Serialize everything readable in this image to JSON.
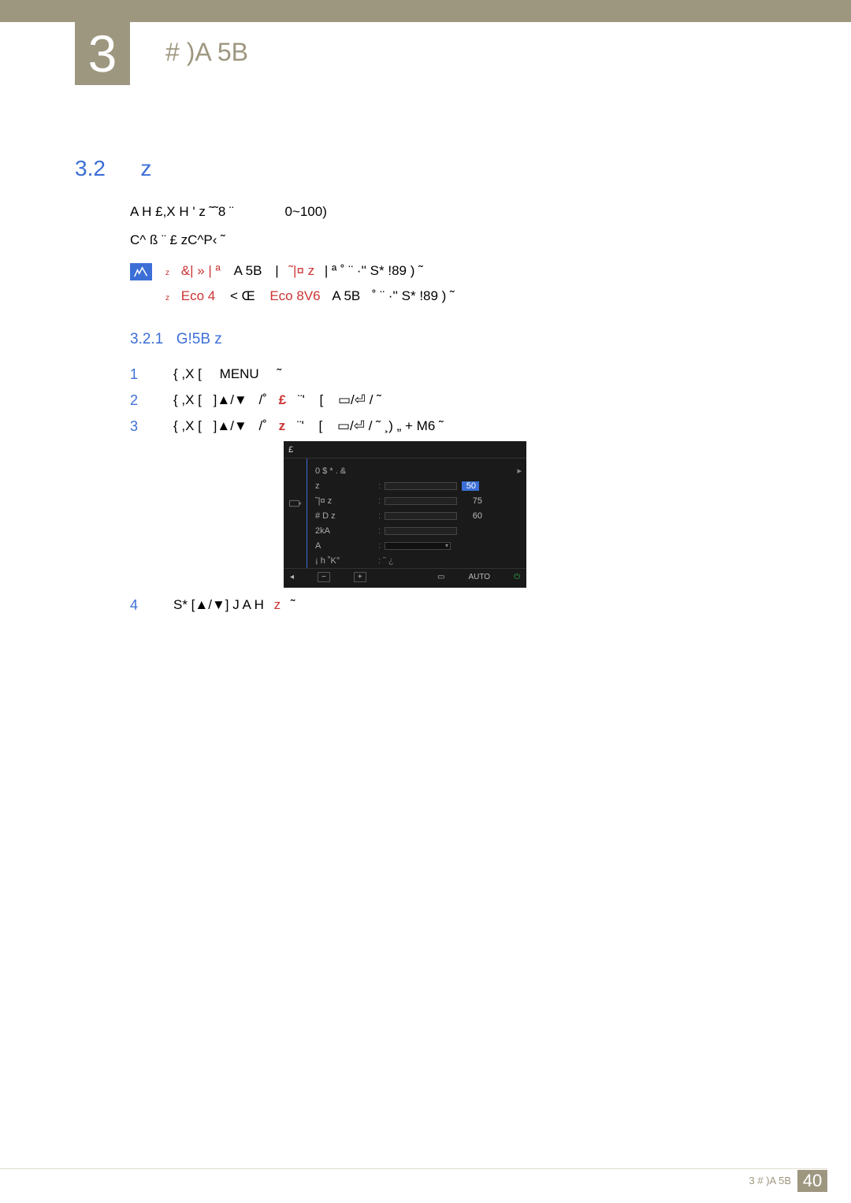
{
  "chapter": {
    "number": "3",
    "title": "# )A 5B"
  },
  "section": {
    "number": "3.2",
    "title": "z"
  },
  "intro": {
    "line1_left": "A H  £,X H '  z ˜˜8  ¨",
    "line1_right": "0~100)",
    "line2": " C^ ß ¨  £   zC^P‹ ˜"
  },
  "notes": [
    {
      "pre": "&| » | ª",
      "mid": "A 5B",
      "accent": "˜|¤ z",
      "tail": "  | ª ˚ ¨ ·'' S* !89  ) ˜"
    },
    {
      "pre": "Eco  4",
      "mid": "<  Œ",
      "accent": "Eco 8V6",
      "post": " A 5B",
      "tail": "˚ ¨ ·'' S* !89  ) ˜"
    }
  ],
  "subsection": {
    "number": "3.2.1",
    "title": "G!5B  z"
  },
  "steps": {
    "s1": {
      "num": "1",
      "text_a": "{  ,X [",
      "menu": "MENU",
      "text_c": "˜"
    },
    "s2": {
      "num": "2",
      "text_a": "{  ,X [",
      "arrows": "]▲/▼",
      "mid": "/˚",
      "accent": "£",
      "mid2": "¨'",
      "bracket": "[",
      "tail": "/      ˜"
    },
    "s3": {
      "num": "3",
      "text_a": "{  ,X [",
      "arrows": "]▲/▼",
      "mid": "/˚",
      "accent": "z",
      "mid2": "¨'",
      "bracket": "[",
      "tail": "/      ˜  ¸) „ + M6 ˜"
    },
    "s4": {
      "num": "4",
      "text_a": "S*   [▲/▼]  J A H",
      "accent": "z",
      "tail": "˜"
    }
  },
  "osd": {
    "header": "£",
    "rows": [
      {
        "label": "0 $ * . &",
        "type": "arrow",
        "value": ""
      },
      {
        "label": "z",
        "type": "slider",
        "value": "50",
        "pct": 50,
        "hi": true
      },
      {
        "label": "˜|¤ z",
        "type": "slider",
        "value": "75",
        "pct": 75
      },
      {
        "label": "#  D z",
        "type": "slider",
        "value": "60",
        "pct": 60
      },
      {
        "label": "2kA",
        "type": "slider",
        "value": "",
        "pct": 0
      },
      {
        "label": "A",
        "type": "drop",
        "value": ""
      },
      {
        "label": "¡ h ˚K°",
        "type": "static",
        "value": ":   ˜ ¿"
      }
    ],
    "footer": {
      "left": "◂",
      "minus": "−",
      "plus": "+",
      "auto": "AUTO",
      "power": "⏻"
    }
  },
  "footer": {
    "crumb": "3  # )A 5B",
    "page": "40"
  }
}
